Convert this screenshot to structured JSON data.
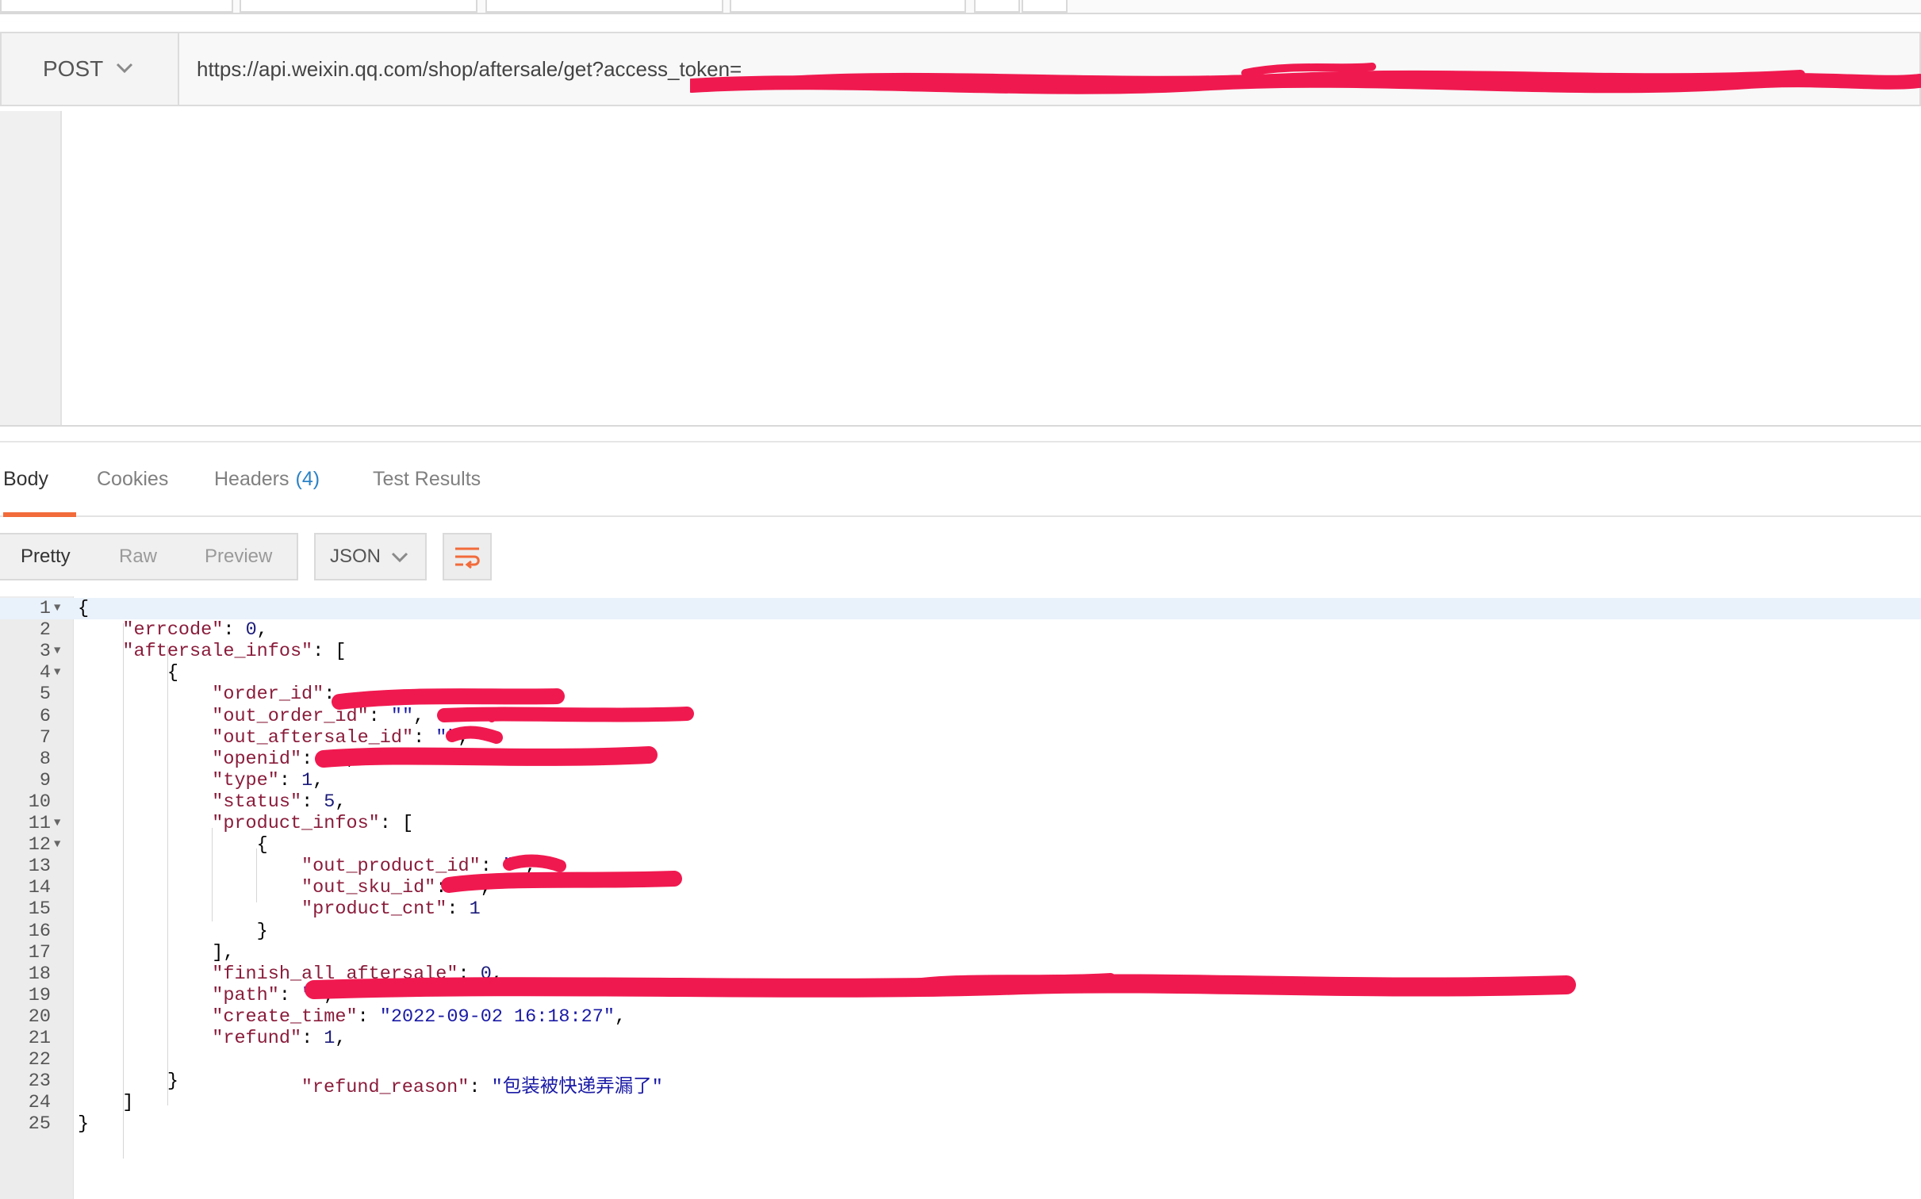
{
  "request": {
    "method": "POST",
    "url": "https://api.weixin.qq.com/shop/aftersale/get?access_token=",
    "method_chevron_icon": "chevron-down-icon"
  },
  "response_tabs": [
    {
      "label": "Body",
      "active": true
    },
    {
      "label": "Cookies",
      "active": false
    },
    {
      "label": "Headers",
      "count": "(4)",
      "active": false
    },
    {
      "label": "Test Results",
      "active": false
    }
  ],
  "format_toolbar": {
    "modes": [
      "Pretty",
      "Raw",
      "Preview"
    ],
    "active_mode": "Pretty",
    "language": "JSON",
    "wrap_icon": "wrap-lines-icon"
  },
  "colors": {
    "accent_orange": "#f26b3a",
    "count_blue": "#2b82c6",
    "json_key": "#8a1c3b",
    "json_string": "#1a1aa6",
    "redaction": "#f0194f"
  },
  "code": {
    "lines": [
      {
        "n": "1",
        "fold": true,
        "text": "{"
      },
      {
        "n": "2",
        "text": "    \"errcode\": 0,"
      },
      {
        "n": "3",
        "fold": true,
        "text": "    \"aftersale_infos\": ["
      },
      {
        "n": "4",
        "fold": true,
        "text": "        {"
      },
      {
        "n": "5",
        "text": "            \"order_id\": ,"
      },
      {
        "n": "6",
        "text": "            \"out_order_id\": \"\","
      },
      {
        "n": "7",
        "text": "            \"out_aftersale_id\": \"\","
      },
      {
        "n": "8",
        "text": "            \"openid\": \"\","
      },
      {
        "n": "9",
        "text": "            \"type\": 1,"
      },
      {
        "n": "10",
        "text": "            \"status\": 5,"
      },
      {
        "n": "11",
        "fold": true,
        "text": "            \"product_infos\": ["
      },
      {
        "n": "12",
        "fold": true,
        "text": "                {"
      },
      {
        "n": "13",
        "text": "                    \"out_product_id\": \"\","
      },
      {
        "n": "14",
        "text": "                    \"out_sku_id\": \"\","
      },
      {
        "n": "15",
        "text": "                    \"product_cnt\": 1"
      },
      {
        "n": "16",
        "text": "                }"
      },
      {
        "n": "17",
        "text": "            ],"
      },
      {
        "n": "18",
        "text": "            \"finish_all_aftersale\": 0,"
      },
      {
        "n": "19",
        "text": "            \"path\": \"\","
      },
      {
        "n": "20",
        "text": "            \"create_time\": \"2022-09-02 16:18:27\","
      },
      {
        "n": "21",
        "text": "            \"refund\": 1,"
      },
      {
        "n": "22",
        "text": ""
      },
      {
        "n": "23",
        "text": "        }"
      },
      {
        "n": "24",
        "text": "    ]"
      },
      {
        "n": "25",
        "text": "}"
      }
    ],
    "refund_reason_line": {
      "key": "\"refund_reason\"",
      "value": "\"包装被快递弄漏了\""
    }
  }
}
